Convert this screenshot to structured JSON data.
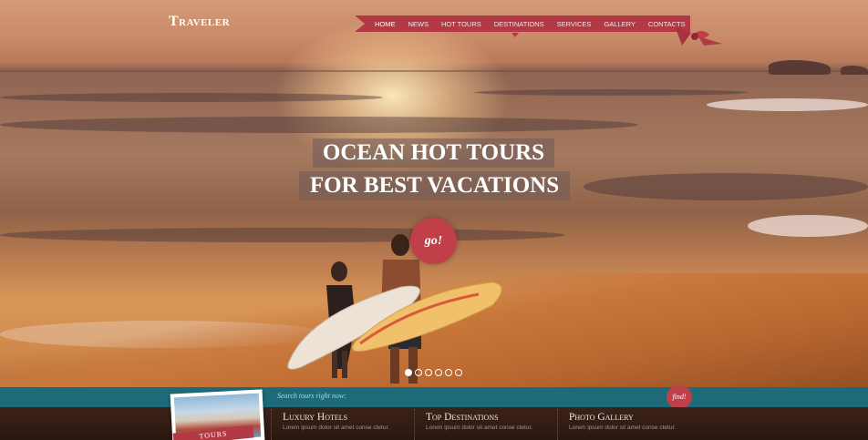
{
  "brand": {
    "logo": "Traveler"
  },
  "nav": {
    "items": [
      "Home",
      "News",
      "Hot Tours",
      "Destinations",
      "Services",
      "Gallery",
      "Contacts"
    ],
    "active": "Home"
  },
  "hero": {
    "line1": "OCEAN HOT TOURS",
    "line2": "FOR BEST VACATIONS",
    "cta": "go!"
  },
  "slider": {
    "dot_count": 6,
    "active_index": 0
  },
  "search": {
    "prompt": "Search tours right now:",
    "button": "find!"
  },
  "promo": {
    "ribbon": "TOURS"
  },
  "columns": [
    {
      "title": "Luxury Hotels",
      "text": "Lorem ipsum dolor sit amet conse ctetur."
    },
    {
      "title": "Top Destinations",
      "text": "Lorem ipsum dolor sit amet conse ctetur."
    },
    {
      "title": "Photo Gallery",
      "text": "Lorem ipsum dolor sit amet conse ctetur."
    }
  ],
  "colors": {
    "accent": "#c0404a",
    "ribbon": "#b33a45",
    "search_bar": "#1d6a78"
  }
}
